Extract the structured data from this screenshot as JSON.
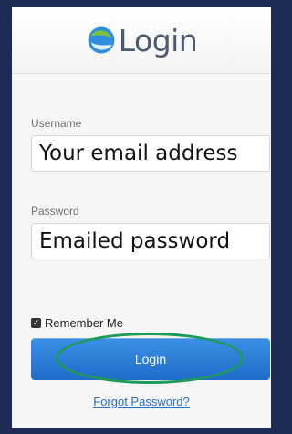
{
  "header": {
    "title": "Login",
    "logo_icon": "swirl-logo-icon",
    "accent": "#2f8fdd"
  },
  "form": {
    "username": {
      "label": "Username",
      "placeholder": "Your email address"
    },
    "password": {
      "label": "Password",
      "placeholder": "Emailed password"
    },
    "remember_me": {
      "label": "Remember Me",
      "checked": true
    },
    "login_button": {
      "label": "Login"
    },
    "forgot_link": {
      "label": "Forgot Password?"
    }
  },
  "colors": {
    "button": "#2879d6",
    "highlight_ring": "#1e9a5a",
    "link": "#2a6dc4",
    "frame": "#1f2b57"
  }
}
